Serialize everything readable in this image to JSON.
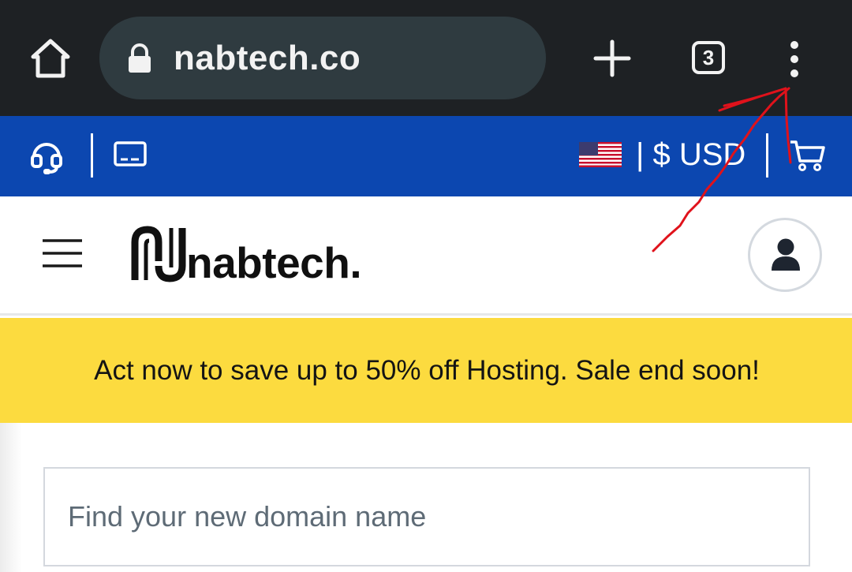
{
  "browser": {
    "url": "nabtech.co",
    "tab_count": "3",
    "icons": [
      "home-icon",
      "lock-icon",
      "new-tab-plus-icon",
      "tab-switcher",
      "more-menu-icon"
    ]
  },
  "topbar": {
    "currency_label": "| $ USD",
    "icons": [
      "support-headset-icon",
      "monitor-icon",
      "us-flag-icon",
      "cart-icon"
    ]
  },
  "header": {
    "logo_text": "nabtech.",
    "icons": [
      "hamburger-menu-icon",
      "logo-mark",
      "account-icon"
    ]
  },
  "promo": {
    "text": "Act now to save up to 50% off Hosting. Sale end soon!"
  },
  "search": {
    "placeholder": "Find your new domain name"
  },
  "colors": {
    "chrome_bg": "#1e2124",
    "urlbar_bg": "#2f3b40",
    "topbar_blue": "#0c47b0",
    "promo_yellow": "#fcdb3f",
    "annotation_red": "#e0121b"
  }
}
